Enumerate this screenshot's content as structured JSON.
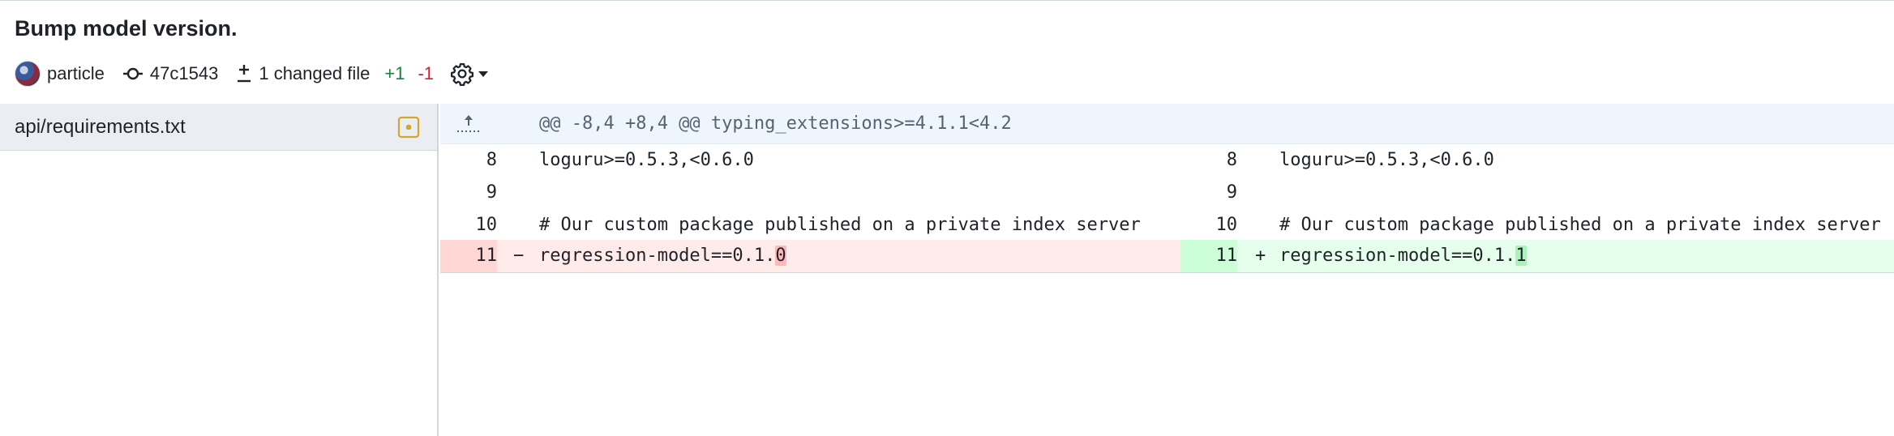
{
  "commit": {
    "title": "Bump model version.",
    "author": "particle",
    "sha": "47c1543",
    "changed_files": "1 changed file",
    "additions": "+1",
    "deletions": "-1"
  },
  "icons": {
    "commit": "git-commit-icon",
    "diff": "file-diff-icon",
    "settings": "gear-icon",
    "caret": "triangle-down-icon",
    "modified": "file-modified-icon",
    "expand": "fold-up-icon"
  },
  "colors": {
    "addition_text": "#1a7f37",
    "deletion_text": "#cf222e",
    "deletion_bg": "#ffebe9",
    "addition_bg": "#e6ffec",
    "modified_icon": "#d4a72c"
  },
  "sidebar": {
    "files": [
      {
        "name": "api/requirements.txt"
      }
    ]
  },
  "diff": {
    "hunk_header": "@@ -8,4 +8,4 @@ typing_extensions>=4.1.1<4.2",
    "rows": [
      {
        "left_num": "8",
        "left_code": "loguru>=0.5.3,<0.6.0",
        "right_num": "8",
        "right_code": "loguru>=0.5.3,<0.6.0"
      },
      {
        "left_num": "9",
        "left_code": "",
        "right_num": "9",
        "right_code": ""
      },
      {
        "left_num": "10",
        "left_code": "# Our custom package published on a private index server",
        "right_num": "10",
        "right_code": "# Our custom package published on a private index server"
      }
    ],
    "changed_row": {
      "left_num": "11",
      "left_marker": "−",
      "left_prefix": "regression-model==0.1.",
      "left_changed": "0",
      "right_num": "11",
      "right_marker": "+",
      "right_prefix": "regression-model==0.1.",
      "right_changed": "1"
    }
  }
}
